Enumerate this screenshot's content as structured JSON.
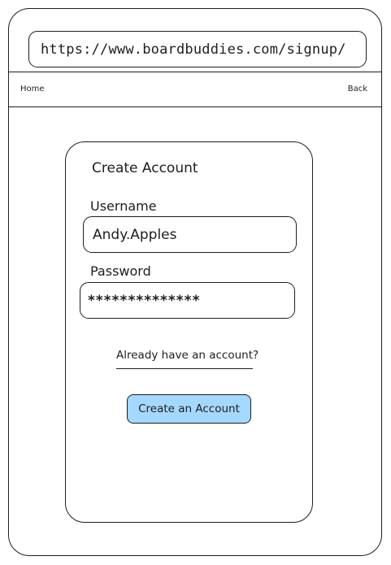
{
  "browser": {
    "url": "https://www.boardbuddies.com/signup/"
  },
  "nav": {
    "home_label": "Home",
    "back_label": "Back"
  },
  "form": {
    "title": "Create Account",
    "username_label": "Username",
    "username_value": "Andy.Apples",
    "password_label": "Password",
    "password_value": "**************",
    "already_link": "Already have an account?",
    "submit_label": "Create an Account"
  },
  "colors": {
    "button_fill": "#a5d8ff",
    "stroke": "#1e1e1e"
  }
}
